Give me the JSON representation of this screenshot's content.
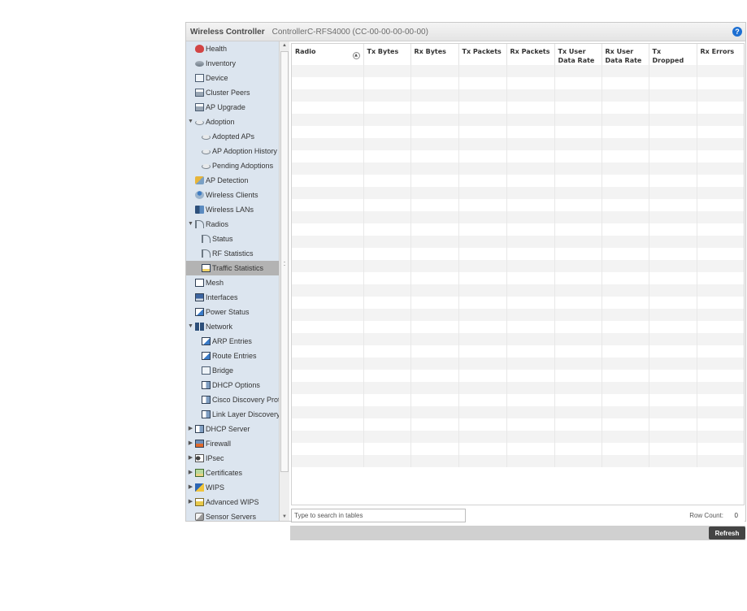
{
  "header": {
    "app_title": "Wireless Controller",
    "controller": "ControllerC-RFS4000 (CC-00-00-00-00-00)",
    "help_label": "?"
  },
  "sidebar": {
    "items": [
      {
        "label": "Health",
        "icon": "heart-icon",
        "level": 0,
        "expander": ""
      },
      {
        "label": "Inventory",
        "icon": "disk-icon",
        "level": 0,
        "expander": ""
      },
      {
        "label": "Device",
        "icon": "device-icon",
        "level": 0,
        "expander": ""
      },
      {
        "label": "Cluster Peers",
        "icon": "cluster-icon",
        "level": 0,
        "expander": ""
      },
      {
        "label": "AP Upgrade",
        "icon": "upgrade-icon",
        "level": 0,
        "expander": ""
      },
      {
        "label": "Adoption",
        "icon": "access-point-icon",
        "level": 0,
        "expander": "▼"
      },
      {
        "label": "Adopted APs",
        "icon": "access-point-icon",
        "level": 1,
        "expander": ""
      },
      {
        "label": "AP Adoption History",
        "icon": "access-point-icon",
        "level": 1,
        "expander": ""
      },
      {
        "label": "Pending Adoptions",
        "icon": "access-point-icon",
        "level": 1,
        "expander": ""
      },
      {
        "label": "AP Detection",
        "icon": "warning-icon",
        "level": 0,
        "expander": ""
      },
      {
        "label": "Wireless Clients",
        "icon": "client-icon",
        "level": 0,
        "expander": ""
      },
      {
        "label": "Wireless LANs",
        "icon": "wlan-icon",
        "level": 0,
        "expander": ""
      },
      {
        "label": "Radios",
        "icon": "radio-icon",
        "level": 0,
        "expander": "▼"
      },
      {
        "label": "Status",
        "icon": "radio-icon",
        "level": 1,
        "expander": ""
      },
      {
        "label": "RF Statistics",
        "icon": "radio-icon",
        "level": 1,
        "expander": ""
      },
      {
        "label": "Traffic Statistics",
        "icon": "chart-icon",
        "level": 1,
        "expander": "",
        "selected": true
      },
      {
        "label": "Mesh",
        "icon": "mesh-icon",
        "level": 0,
        "expander": ""
      },
      {
        "label": "Interfaces",
        "icon": "monitor-icon",
        "level": 0,
        "expander": ""
      },
      {
        "label": "Power Status",
        "icon": "power-icon",
        "level": 0,
        "expander": ""
      },
      {
        "label": "Network",
        "icon": "network-icon",
        "level": 0,
        "expander": "▼"
      },
      {
        "label": "ARP Entries",
        "icon": "power-icon",
        "level": 1,
        "expander": ""
      },
      {
        "label": "Route Entries",
        "icon": "power-icon",
        "level": 1,
        "expander": ""
      },
      {
        "label": "Bridge",
        "icon": "bridge-icon",
        "level": 1,
        "expander": ""
      },
      {
        "label": "DHCP Options",
        "icon": "dhcp-icon",
        "level": 1,
        "expander": ""
      },
      {
        "label": "Cisco Discovery Prot",
        "icon": "dhcp-icon",
        "level": 1,
        "expander": ""
      },
      {
        "label": "Link Layer Discovery",
        "icon": "dhcp-icon",
        "level": 1,
        "expander": ""
      },
      {
        "label": "DHCP Server",
        "icon": "dhcp-icon",
        "level": 0,
        "expander": "▶"
      },
      {
        "label": "Firewall",
        "icon": "firewall-icon",
        "level": 0,
        "expander": "▶"
      },
      {
        "label": "IPsec",
        "icon": "key-icon",
        "level": 0,
        "expander": "▶"
      },
      {
        "label": "Certificates",
        "icon": "certificate-icon",
        "level": 0,
        "expander": "▶"
      },
      {
        "label": "WIPS",
        "icon": "wips-icon",
        "level": 0,
        "expander": "▶"
      },
      {
        "label": "Advanced WIPS",
        "icon": "advanced-wips-icon",
        "level": 0,
        "expander": "▶"
      },
      {
        "label": "Sensor Servers",
        "icon": "sensor-icon",
        "level": 0,
        "expander": ""
      }
    ]
  },
  "table": {
    "columns": [
      "Radio",
      "Tx Bytes",
      "Rx Bytes",
      "Tx Packets",
      "Rx Packets",
      "Tx User Data Rate",
      "Rx User Data Rate",
      "Tx Dropped",
      "Rx Errors"
    ],
    "sort_indicator": "▲",
    "empty_rows": 33
  },
  "search": {
    "placeholder": "Type to search in tables",
    "value": ""
  },
  "row_count": {
    "label": "Row Count:",
    "value": "0"
  },
  "buttons": {
    "refresh": "Refresh"
  }
}
